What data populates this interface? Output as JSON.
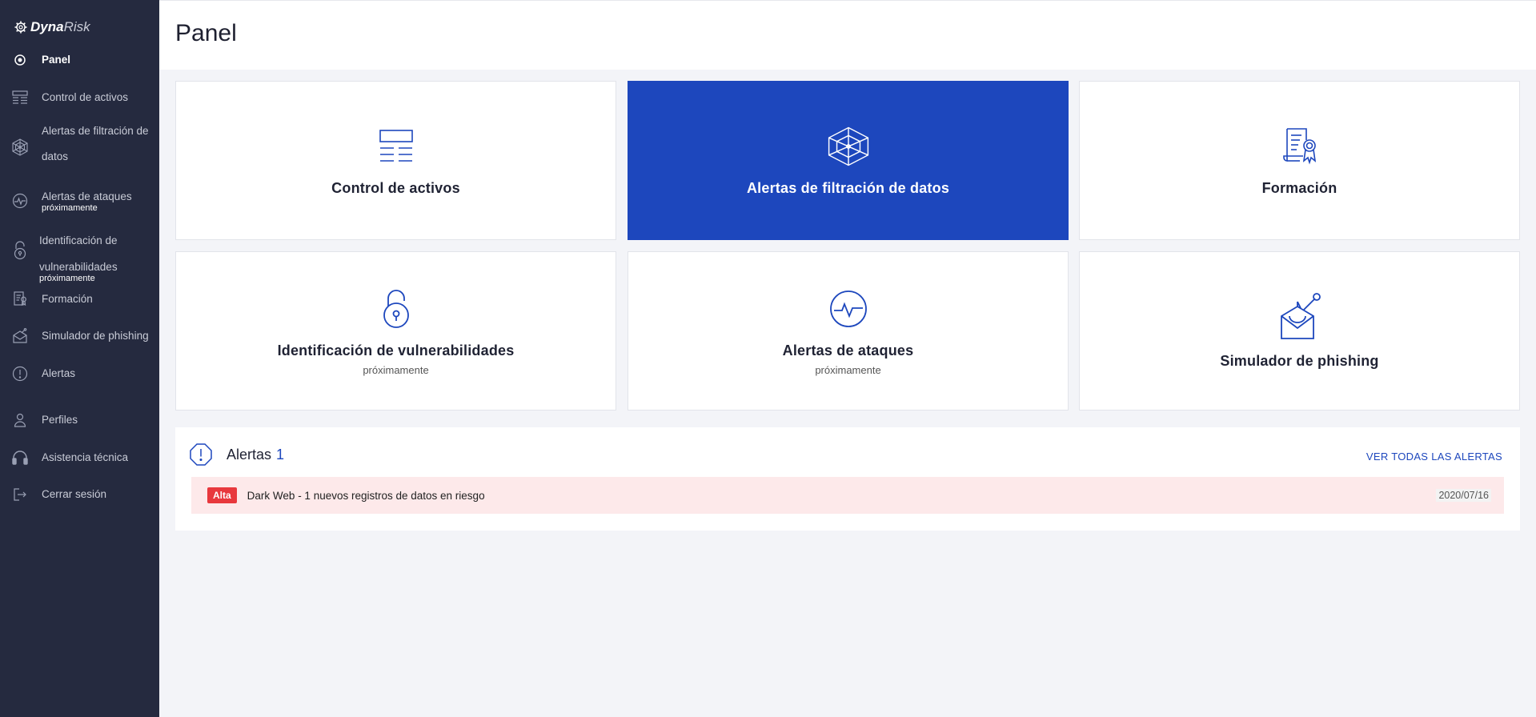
{
  "brand": {
    "part1": "Dyna",
    "part2": "Risk"
  },
  "sidebar": {
    "items": [
      {
        "label": "Panel",
        "icon": "radio-target-icon",
        "active": true
      },
      {
        "label": "Control de activos",
        "icon": "assets-list-icon"
      },
      {
        "label": "Alertas de filtración de datos",
        "icon": "web-icon"
      },
      {
        "label": "Alertas de ataques",
        "sub": "próximamente",
        "icon": "pulse-icon"
      },
      {
        "label": "Identificación de vulnerabilidades",
        "sub": "próximamente",
        "icon": "lock-icon"
      },
      {
        "label": "Formación",
        "icon": "certificate-icon"
      },
      {
        "label": "Simulador de phishing",
        "icon": "phishing-icon"
      },
      {
        "label": "Alertas",
        "icon": "alert-icon"
      },
      {
        "label": "Perfiles",
        "icon": "user-icon"
      },
      {
        "label": "Asistencia técnica",
        "icon": "headset-icon"
      },
      {
        "label": "Cerrar sesión",
        "icon": "logout-icon"
      }
    ]
  },
  "header": {
    "title": "Panel"
  },
  "cards": [
    {
      "title": "Control de activos",
      "icon": "assets-list-icon"
    },
    {
      "title": "Alertas de filtración de datos",
      "icon": "web-icon",
      "active": true
    },
    {
      "title": "Formación",
      "icon": "certificate-icon"
    },
    {
      "title": "Identificación de vulnerabilidades",
      "sub": "próximamente",
      "icon": "lock-icon"
    },
    {
      "title": "Alertas de ataques",
      "sub": "próximamente",
      "icon": "pulse-icon"
    },
    {
      "title": "Simulador de phishing",
      "icon": "phishing-icon"
    }
  ],
  "alerts": {
    "title": "Alertas",
    "count": "1",
    "see_all": "VER TODAS LAS ALERTAS",
    "rows": [
      {
        "badge": "Alta",
        "text": "Dark Web - 1 nuevos registros de datos en riesgo",
        "date": "2020/07/16"
      }
    ]
  },
  "colors": {
    "sidebar": "#252a3f",
    "accent": "#1d47bd",
    "alert_bg": "#fde9ea",
    "badge": "#e8383d"
  }
}
